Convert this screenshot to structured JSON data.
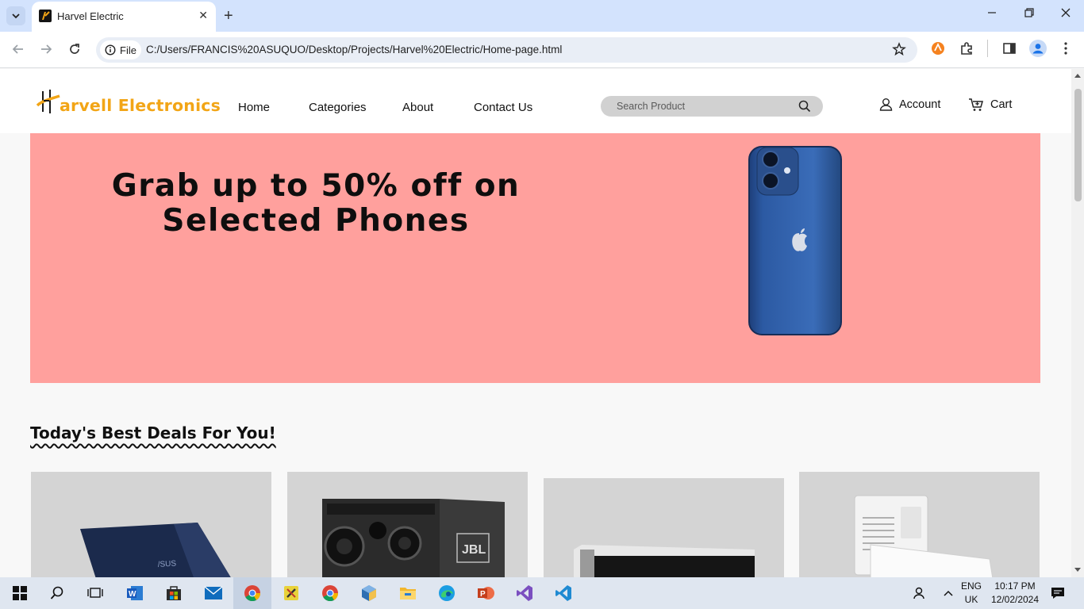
{
  "browser": {
    "tab_title": "Harvel Electric",
    "address_chip": "File",
    "url": "C:/Users/FRANCIS%20ASUQUO/Desktop/Projects/Harvel%20Electric/Home-page.html"
  },
  "site": {
    "logo_text": "arvell Electronics",
    "nav": [
      "Home",
      "Categories",
      "About",
      "Contact Us"
    ],
    "search_placeholder": "Search Product",
    "account_label": "Account",
    "cart_label": "Cart",
    "banner": {
      "line1": "Grab up to 50% off on",
      "line2": "Selected Phones",
      "background": "#ffa09d"
    },
    "deals_title": "Today's Best Deals For You!",
    "products": [
      {
        "icon": "laptop-image"
      },
      {
        "icon": "speaker-image"
      },
      {
        "icon": "tv-image"
      },
      {
        "icon": "air-conditioner-image"
      }
    ]
  },
  "taskbar": {
    "lang_top": "ENG",
    "lang_bottom": "UK",
    "time": "10:17 PM",
    "date": "12/02/2024",
    "apps": [
      "start-icon",
      "search-icon",
      "task-view-icon",
      "word-icon",
      "store-icon",
      "mail-icon",
      "chrome-icon",
      "tools-icon",
      "chrome-alt-icon",
      "box-icon",
      "file-explorer-icon",
      "edge-icon",
      "powerpoint-icon",
      "visual-studio-icon",
      "vscode-icon"
    ]
  },
  "colors": {
    "brand_orange": "#f2a516",
    "tabbar": "#d3e3fd"
  }
}
